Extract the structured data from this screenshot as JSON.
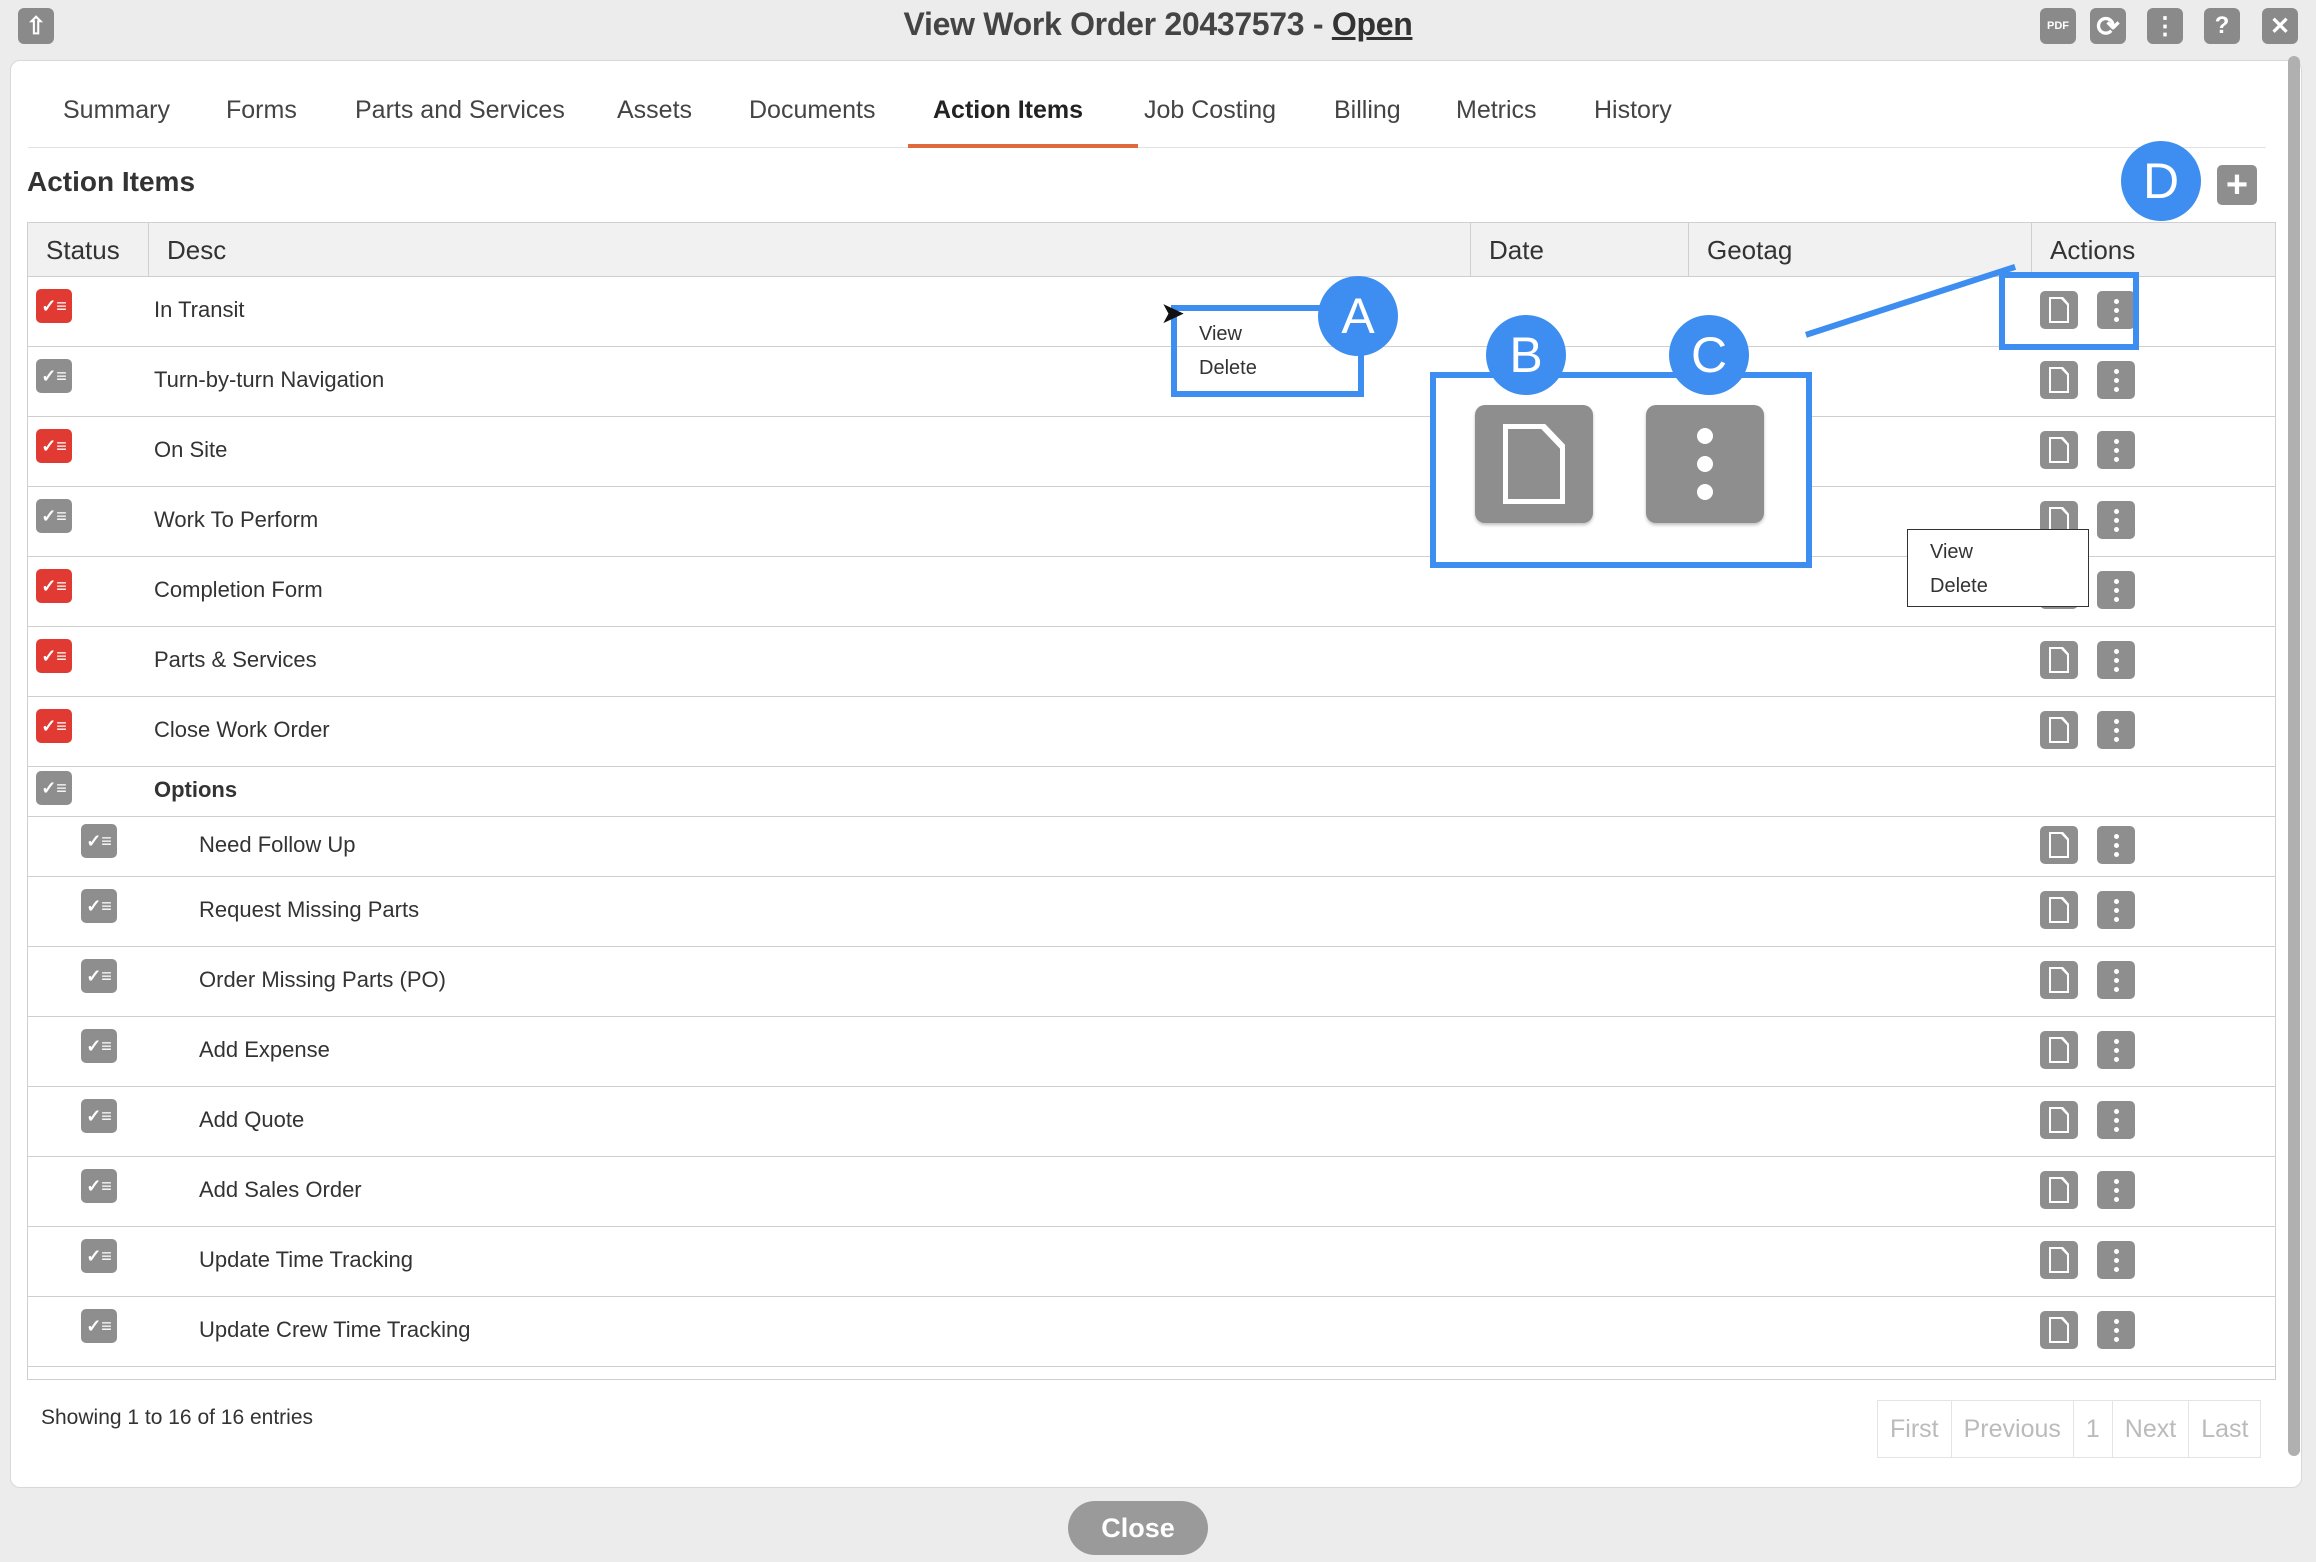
{
  "window": {
    "title": "View Work Order 20437573",
    "separator": " - ",
    "status": "Open",
    "toolbar_icons": [
      "upload-icon",
      "pdf-icon",
      "refresh-icon",
      "more-icon",
      "help-icon",
      "close-icon"
    ],
    "toolbar_glyphs": {
      "pdf": "PDF",
      "refresh": "⟳",
      "more": "⋮",
      "help": "?",
      "close": "✕",
      "upload": "⇧"
    }
  },
  "tabs": [
    {
      "label": "Summary"
    },
    {
      "label": "Forms"
    },
    {
      "label": "Parts and Services"
    },
    {
      "label": "Assets"
    },
    {
      "label": "Documents"
    },
    {
      "label": "Action Items",
      "active": true
    },
    {
      "label": "Job Costing"
    },
    {
      "label": "Billing"
    },
    {
      "label": "Metrics"
    },
    {
      "label": "History"
    }
  ],
  "section": {
    "title": "Action Items",
    "add_glyph": "+"
  },
  "table": {
    "columns": [
      "Status",
      "Desc",
      "Date",
      "Geotag",
      "Actions"
    ],
    "check_glyph": "✓≡",
    "rows": [
      {
        "desc": "In Transit",
        "status_color": "red"
      },
      {
        "desc": "Turn-by-turn Navigation",
        "status_color": "gray"
      },
      {
        "desc": "On Site",
        "status_color": "red"
      },
      {
        "desc": "Work To Perform",
        "status_color": "gray"
      },
      {
        "desc": "Completion Form",
        "status_color": "red"
      },
      {
        "desc": "Parts & Services",
        "status_color": "red"
      },
      {
        "desc": "Close Work Order",
        "status_color": "red"
      },
      {
        "desc": "Options",
        "status_color": "gray",
        "group": true
      },
      {
        "desc": "Need Follow Up",
        "status_color": "gray",
        "child": true
      },
      {
        "desc": "Request Missing Parts",
        "status_color": "gray",
        "child": true
      },
      {
        "desc": "Order Missing Parts (PO)",
        "status_color": "gray",
        "child": true
      },
      {
        "desc": "Add Expense",
        "status_color": "gray",
        "child": true
      },
      {
        "desc": "Add Quote",
        "status_color": "gray",
        "child": true
      },
      {
        "desc": "Add Sales Order",
        "status_color": "gray",
        "child": true
      },
      {
        "desc": "Update Time Tracking",
        "status_color": "gray",
        "child": true
      },
      {
        "desc": "Update Crew Time Tracking",
        "status_color": "gray",
        "child": true
      }
    ]
  },
  "context_menu": {
    "items": [
      "View",
      "Delete"
    ]
  },
  "annotations": {
    "a": "A",
    "b": "B",
    "c": "C",
    "d": "D"
  },
  "footer": {
    "entries_text": "Showing 1 to 16 of 16 entries",
    "pager": [
      "First",
      "Previous",
      "1",
      "Next",
      "Last"
    ],
    "close_label": "Close"
  },
  "colors": {
    "accent_tab": "#e06a3b",
    "status_red": "#e03a32",
    "status_gray": "#8e8e8e",
    "annotation_blue": "#3d8ef0"
  }
}
